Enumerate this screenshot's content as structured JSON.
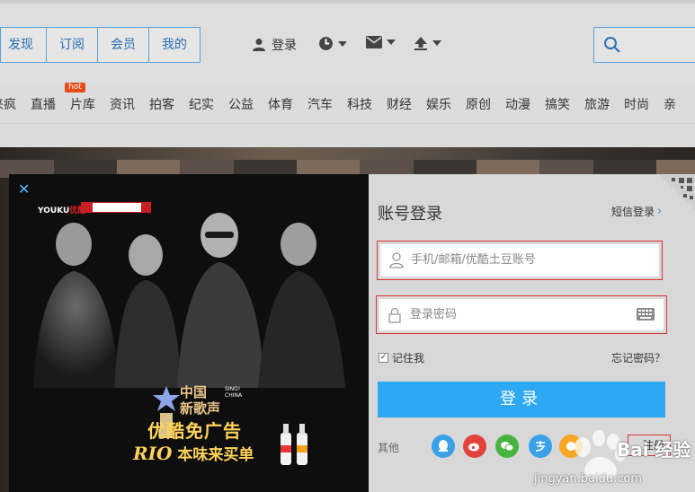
{
  "top_tabs": [
    "发现",
    "订阅",
    "会员",
    "我的"
  ],
  "header": {
    "login_label": "登录"
  },
  "categories": [
    "来疯",
    "直播",
    "片库",
    "资讯",
    "拍客",
    "纪实",
    "公益",
    "体育",
    "汽车",
    "科技",
    "财经",
    "娱乐",
    "原创",
    "动漫",
    "搞笑",
    "旅游",
    "时尚",
    "亲"
  ],
  "hot_badge": "hot",
  "promo": {
    "brand_cn": "中国\n新歌声",
    "brand_en": "SING!\nCHINA",
    "line1": "优酷免广告",
    "line2_brand": "RIO",
    "line2_text": "本味来买单"
  },
  "login_form": {
    "title": "账号登录",
    "sms_login": "短信登录",
    "username_placeholder": "手机/邮箱/优酷土豆账号",
    "password_placeholder": "登录密码",
    "remember_label": "记住我",
    "remember_checked": true,
    "forgot_password": "忘记密码？",
    "submit_label": "登录",
    "third_party_label": "其他",
    "register_label": "注册"
  },
  "watermark": {
    "text": "Bai 经验",
    "url": "jingyan.baidu.com"
  },
  "colors": {
    "accent_blue": "#2ea8f2",
    "tab_blue": "#2b6fb3",
    "hot_badge": "#e64a19",
    "promo_gold": "#ffd35a"
  }
}
